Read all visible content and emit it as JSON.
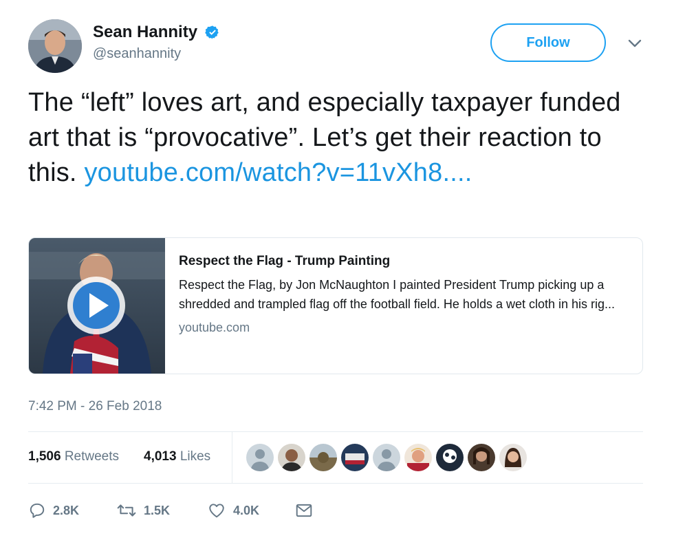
{
  "user": {
    "display_name": "Sean Hannity",
    "handle": "@seanhannity",
    "verified": true,
    "avatar_icon": "profile-photo"
  },
  "follow_label": "Follow",
  "tweet": {
    "text": "The “left” loves art, and especially taxpayer funded art that is “provocative”. Let’s get their reaction to this.",
    "link_text": "youtube.com/watch?v=11vXh8...."
  },
  "card": {
    "title": "Respect the Flag - Trump Painting",
    "description": "Respect the Flag, by Jon McNaughton I painted President Trump picking up a shredded and trampled flag off the football field. He holds a wet cloth in his rig...",
    "domain": "youtube.com",
    "thumbnail_icon": "video-play-icon"
  },
  "timestamp": "7:42 PM - 26 Feb 2018",
  "stats": {
    "retweets_count": "1,506",
    "retweets_label": "Retweets",
    "likes_count": "4,013",
    "likes_label": "Likes"
  },
  "actions": {
    "reply_count": "2.8K",
    "retweet_count": "1.5K",
    "like_count": "4.0K"
  },
  "colors": {
    "accent": "#1da1f2",
    "link": "#1b95e0",
    "secondary_text": "#657786"
  }
}
